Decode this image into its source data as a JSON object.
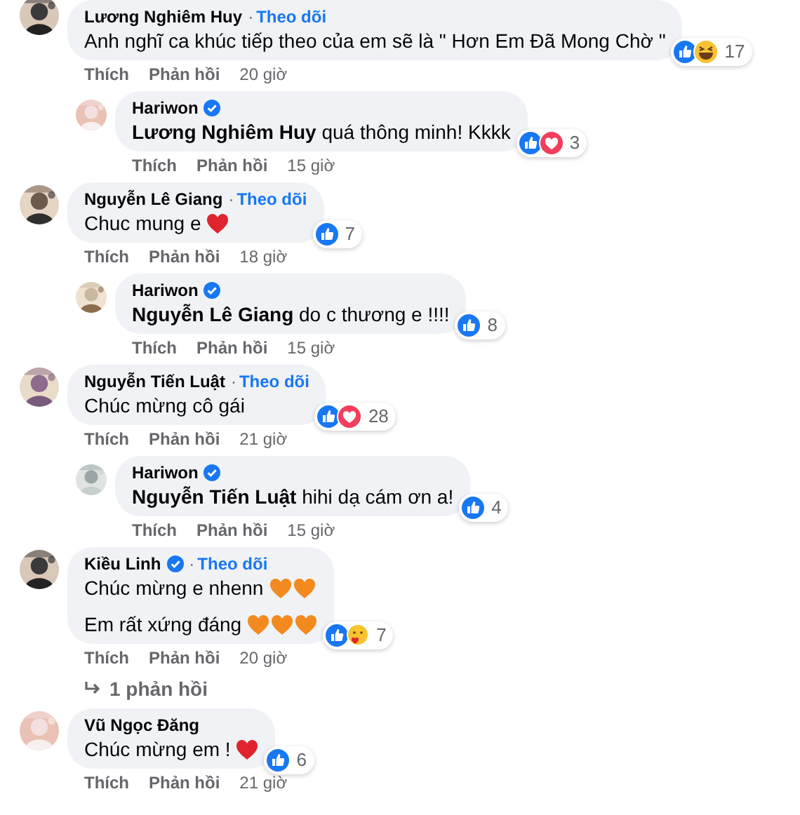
{
  "comments": [
    {
      "author": "Lương Nghiêm Huy",
      "verified": false,
      "follow": {
        "separator": "·",
        "label": "Theo dõi"
      },
      "lines": [
        {
          "text": "Anh nghĩ ca khúc tiếp theo của em sẽ là \" Hơn Em Đã Mong Chờ \""
        }
      ],
      "reactions": [
        {
          "kind": "like"
        },
        {
          "kind": "haha"
        }
      ],
      "count": "17",
      "actions": [
        "Thích",
        "Phản hồi"
      ],
      "time": "20 giờ",
      "children": [
        {
          "author": "Hariwon",
          "verified": true,
          "lines": [
            {
              "mention": "Lương Nghiêm Huy",
              "text": "quá thông minh! Kkkk"
            }
          ],
          "reactions": [
            {
              "kind": "like"
            },
            {
              "kind": "love"
            }
          ],
          "count": "3",
          "actions": [
            "Thích",
            "Phản hồi"
          ],
          "time": "15 giờ"
        }
      ]
    },
    {
      "author": "Nguyễn Lê Giang",
      "verified": false,
      "follow": {
        "separator": "·",
        "label": "Theo dõi"
      },
      "lines": [
        {
          "text": "Chuc mung e",
          "hearts": [
            {
              "kind": "red"
            }
          ]
        }
      ],
      "reactions": [
        {
          "kind": "like"
        }
      ],
      "count": "7",
      "actions": [
        "Thích",
        "Phản hồi"
      ],
      "time": "18 giờ",
      "children": [
        {
          "author": "Hariwon",
          "verified": true,
          "lines": [
            {
              "mention": "Nguyễn Lê Giang",
              "text": "do c thương e !!!!"
            }
          ],
          "reactions": [
            {
              "kind": "like"
            }
          ],
          "count": "8",
          "actions": [
            "Thích",
            "Phản hồi"
          ],
          "time": "15 giờ"
        }
      ]
    },
    {
      "author": "Nguyễn Tiến Luật",
      "verified": false,
      "follow": {
        "separator": "·",
        "label": "Theo dõi"
      },
      "lines": [
        {
          "text": "Chúc mừng cô gái"
        }
      ],
      "reactions": [
        {
          "kind": "like"
        },
        {
          "kind": "love"
        }
      ],
      "count": "28",
      "actions": [
        "Thích",
        "Phản hồi"
      ],
      "time": "21 giờ",
      "children": [
        {
          "author": "Hariwon",
          "verified": true,
          "lines": [
            {
              "mention": "Nguyễn Tiến Luật",
              "text": "hihi dạ cám ơn a!"
            }
          ],
          "reactions": [
            {
              "kind": "like"
            }
          ],
          "count": "4",
          "actions": [
            "Thích",
            "Phản hồi"
          ],
          "time": "15 giờ"
        }
      ]
    },
    {
      "author": "Kiều Linh",
      "verified": true,
      "follow": {
        "separator": "·",
        "label": "Theo dõi"
      },
      "lines": [
        {
          "text": "Chúc mừng e nhenn",
          "hearts": [
            {
              "kind": "orange"
            },
            {
              "kind": "orange"
            }
          ]
        },
        {
          "text": "Em rất xứng đáng",
          "hearts": [
            {
              "kind": "orange"
            },
            {
              "kind": "orange"
            },
            {
              "kind": "orange"
            }
          ]
        }
      ],
      "reactions": [
        {
          "kind": "like"
        },
        {
          "kind": "care"
        }
      ],
      "count": "7",
      "actions": [
        "Thích",
        "Phản hồi"
      ],
      "time": "20 giờ",
      "more_replies": "1 phản hồi"
    },
    {
      "author": "Vũ Ngọc Đăng",
      "verified": false,
      "lines": [
        {
          "text": "Chúc mừng em !",
          "hearts": [
            {
              "kind": "red"
            }
          ]
        }
      ],
      "reactions": [
        {
          "kind": "like"
        }
      ],
      "count": "6",
      "actions": [
        "Thích",
        "Phản hồi"
      ],
      "time": "21 giờ"
    }
  ]
}
